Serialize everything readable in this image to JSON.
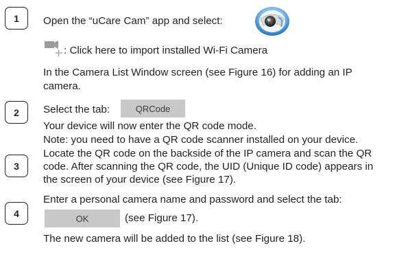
{
  "steps": [
    {
      "number": "1"
    },
    {
      "number": "2"
    },
    {
      "number": "3"
    },
    {
      "number": "4"
    }
  ],
  "step1": {
    "line1": "Open the “uCare Cam” app and select:",
    "import_text": ": Click here to import installed Wi-Fi Camera",
    "line3": "In the Camera List Window screen (see Figure 16) for adding an IP",
    "line4": "camera."
  },
  "step2": {
    "select_text": "Select the tab:",
    "tab_label": "QRCode",
    "line2": "Your device will now enter the QR code mode.",
    "line3": "Note: you need to have a QR code scanner installed on your device."
  },
  "step3": {
    "line1": "Locate the QR code on the backside of the IP camera and scan the QR",
    "line2": "code. After scanning the QR code, the UID (Unique ID code) appears in",
    "line3": "the screen of your device (see Figure 17)."
  },
  "step4": {
    "line1": "Enter a personal camera name and password and select the tab:",
    "ok_label": "OK",
    "see_text": "(see Figure 17).",
    "line3": "The new camera will be added to the list (see Figure 18)."
  },
  "icons": {
    "app": "ucare-cam-app-icon",
    "camera": "add-camera-icon"
  },
  "colors": {
    "text": "#231f20",
    "button_bg": "#c8c8c8",
    "icon_blue": "#2f8fd8"
  }
}
